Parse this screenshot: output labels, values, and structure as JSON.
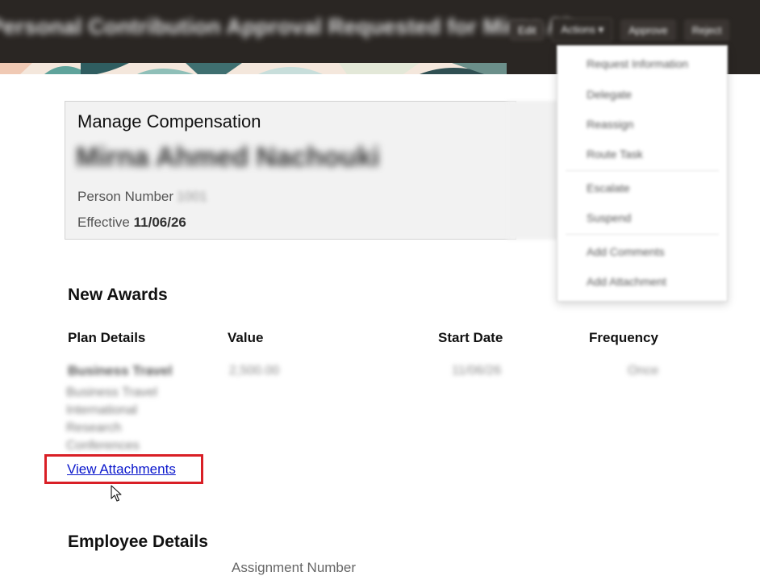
{
  "header": {
    "title": "Personal Contribution Approval Requested for Mirna Ah...",
    "buttons": [
      "Edit",
      "Actions",
      "Approve",
      "Reject"
    ]
  },
  "menu": {
    "items": [
      "Request Information",
      "Delegate",
      "Reassign",
      "Route Task",
      "Escalate",
      "Suspend",
      "Add Comments",
      "Add Attachment"
    ]
  },
  "card": {
    "title": "Manage Compensation",
    "person_name": "Mirna Ahmed Nachouki",
    "person_number_label": "Person Number",
    "person_number_value": "1001",
    "effective_label": "Effective",
    "effective_value": "11/06/26"
  },
  "new_awards": {
    "title": "New Awards",
    "columns": [
      "Plan Details",
      "Value",
      "Start Date",
      "Frequency"
    ],
    "rows": [
      {
        "plan_name": "Business Travel",
        "plan_desc": "Business Travel International Research Conferences",
        "value": "2,500.00",
        "start_date": "11/06/26",
        "frequency": "Once"
      }
    ],
    "attachments_link": "View Attachments"
  },
  "employee_details": {
    "title": "Employee Details",
    "assignment_number_label": "Assignment Number"
  },
  "colors": {
    "header_bg": "#2a2623",
    "link": "#0a17cc",
    "highlight": "#d91f26"
  }
}
